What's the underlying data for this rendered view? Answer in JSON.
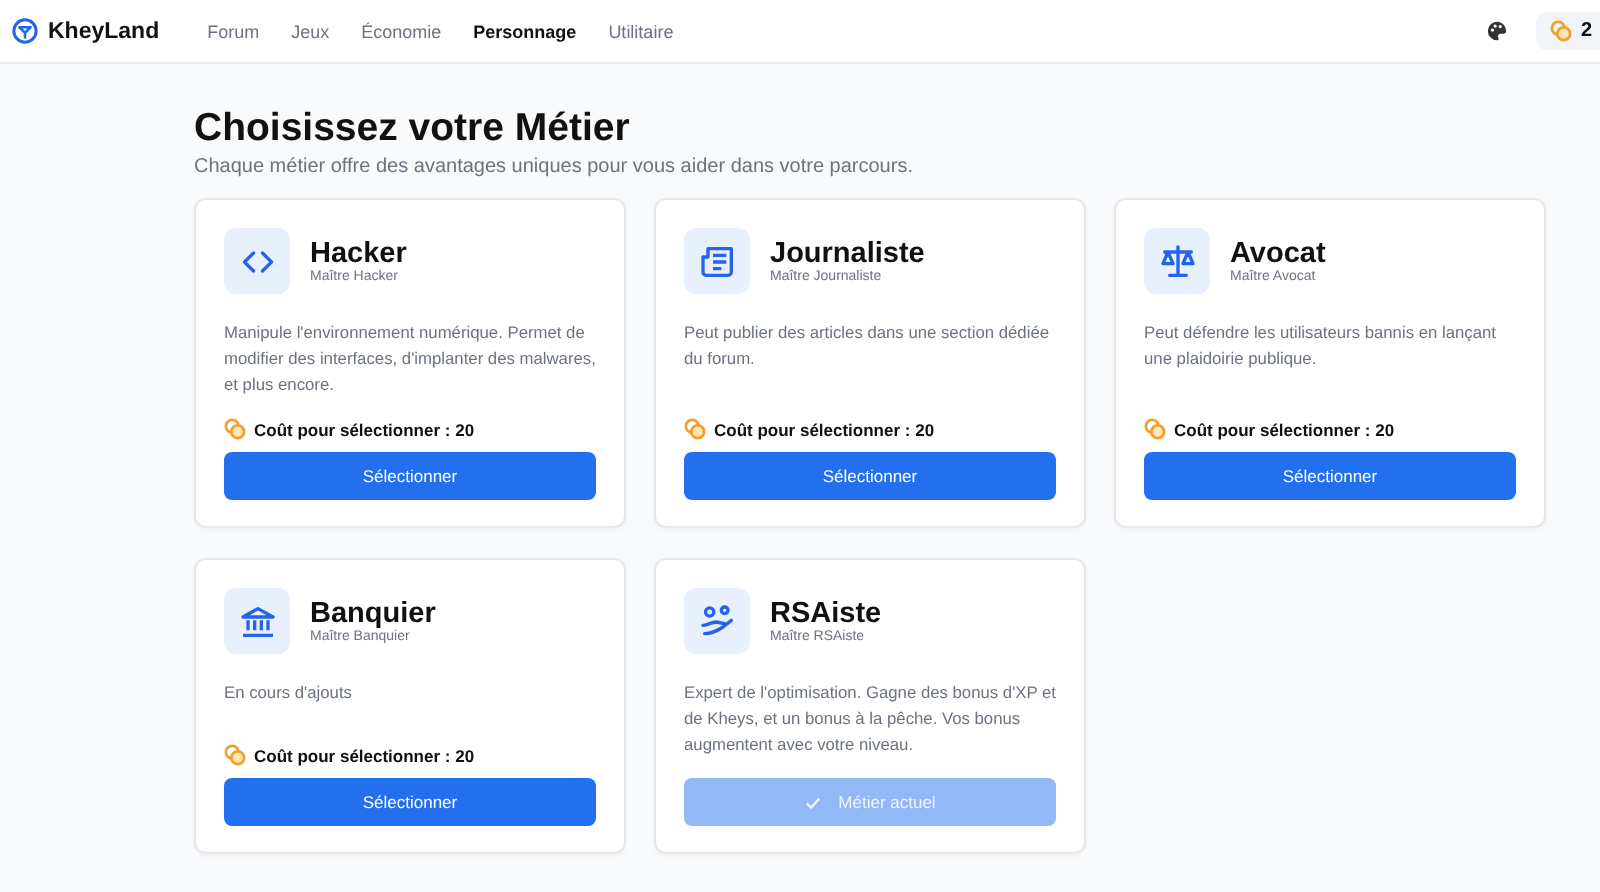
{
  "header": {
    "brand": "KheyLand",
    "nav": [
      {
        "label": "Forum",
        "selected": false
      },
      {
        "label": "Jeux",
        "selected": false
      },
      {
        "label": "Économie",
        "selected": false
      },
      {
        "label": "Personnage",
        "selected": true
      },
      {
        "label": "Utilitaire",
        "selected": false
      }
    ],
    "balance": "2"
  },
  "page": {
    "title": "Choisissez votre Métier",
    "subtitle": "Chaque métier offre des avantages uniques pour vous aider dans votre parcours."
  },
  "jobs": [
    {
      "name": "Hacker",
      "rank": "Maître Hacker",
      "description": "Manipule l'environnement numérique. Permet de modifier des interfaces, d'implanter des malwares, et plus encore.",
      "current": false,
      "cost": "Coût pour sélectionner : 20",
      "button": "Sélectionner"
    },
    {
      "name": "Journaliste",
      "rank": "Maître Journaliste",
      "description": "Peut publier des articles dans une section dédiée du forum.",
      "current": false,
      "cost": "Coût pour sélectionner : 20",
      "button": "Sélectionner"
    },
    {
      "name": "Avocat",
      "rank": "Maître Avocat",
      "description": "Peut défendre les utilisateurs bannis en lançant une plaidoirie publique.",
      "current": false,
      "cost": "Coût pour sélectionner : 20",
      "button": "Sélectionner"
    },
    {
      "name": "Banquier",
      "rank": "Maître Banquier",
      "description": "En cours d'ajouts",
      "current": false,
      "cost": "Coût pour sélectionner : 20",
      "button": "Sélectionner"
    },
    {
      "name": "RSAiste",
      "rank": "Maître RSAiste",
      "description": "Expert de l'optimisation. Gagne des bonus d'XP et de Kheys, et un bonus à la pêche. Vos bonus augmentent avec votre niveau.",
      "current": true,
      "button": "Métier actuel"
    }
  ]
}
